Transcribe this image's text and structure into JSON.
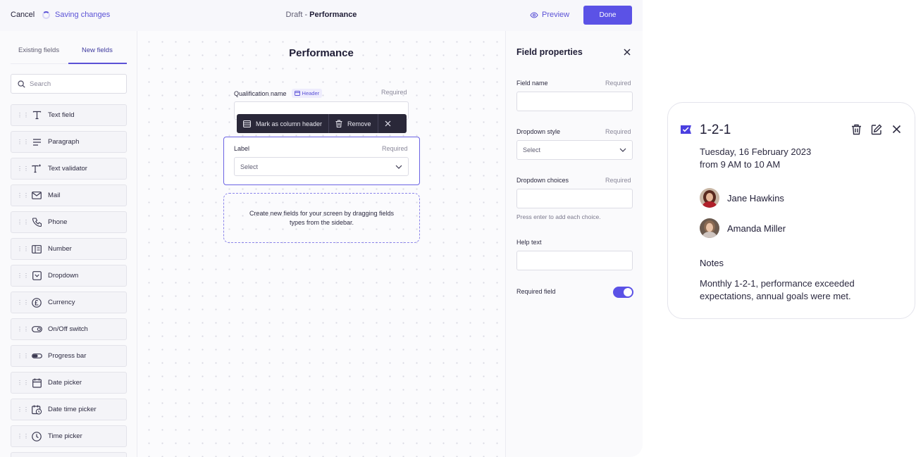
{
  "topbar": {
    "cancel_label": "Cancel",
    "saving_label": "Saving changes",
    "draft_prefix": "Draft - ",
    "doc_name": "Performance",
    "preview_label": "Preview",
    "done_label": "Done"
  },
  "sidebar": {
    "tabs": [
      {
        "label": "Existing fields",
        "active": false
      },
      {
        "label": "New fields",
        "active": true
      }
    ],
    "search_placeholder": "Search",
    "items": [
      {
        "label": "Text field",
        "icon": "text-icon"
      },
      {
        "label": "Paragraph",
        "icon": "paragraph-icon"
      },
      {
        "label": "Text validator",
        "icon": "text-validator-icon"
      },
      {
        "label": "Mail",
        "icon": "mail-icon"
      },
      {
        "label": "Phone",
        "icon": "phone-icon"
      },
      {
        "label": "Number",
        "icon": "number-icon"
      },
      {
        "label": "Dropdown",
        "icon": "dropdown-icon"
      },
      {
        "label": "Currency",
        "icon": "currency-icon"
      },
      {
        "label": "On/Off switch",
        "icon": "toggle-icon"
      },
      {
        "label": "Progress bar",
        "icon": "progress-icon"
      },
      {
        "label": "Date picker",
        "icon": "calendar-icon"
      },
      {
        "label": "Date time picker",
        "icon": "calendar-clock-icon"
      },
      {
        "label": "Time picker",
        "icon": "clock-icon"
      }
    ]
  },
  "canvas": {
    "title": "Performance",
    "qualification_label": "Qualification name",
    "header_tag": "Header",
    "required": "Required",
    "toolbar": {
      "mark_header": "Mark as column header",
      "remove": "Remove"
    },
    "label_field": {
      "label": "Label",
      "required": "Required",
      "select_value": "Select"
    },
    "drop_zone_text": "Create new fields for your screen by dragging fields types from the sidebar."
  },
  "properties": {
    "title": "Field properties",
    "field_name_label": "Field name",
    "dropdown_style_label": "Dropdown style",
    "dropdown_style_value": "Select",
    "dropdown_choices_label": "Dropdown choices",
    "choices_hint": "Press enter to add each choice.",
    "help_text_label": "Help text",
    "required_field_label": "Required field",
    "required_field_on": true,
    "required": "Required"
  },
  "event_card": {
    "title": "1-2-1",
    "date_line": "Tuesday, 16 February 2023",
    "time_line": "from 9 AM to 10 AM",
    "attendees": [
      {
        "name": "Jane Hawkins"
      },
      {
        "name": "Amanda Miller"
      }
    ],
    "notes_heading": "Notes",
    "notes_text": "Monthly 1-2-1, performance exceeded expectations, annual goals were met."
  },
  "colors": {
    "accent": "#5b52e6",
    "toolbar_bg": "#2a2839",
    "text": "#1f1d36"
  }
}
